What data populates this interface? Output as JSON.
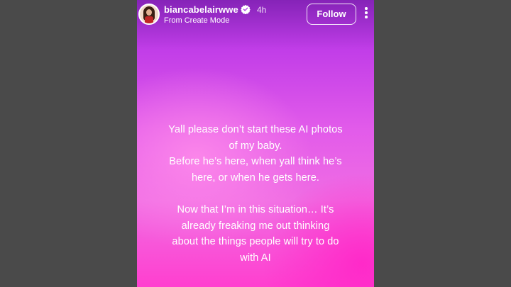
{
  "header": {
    "username": "biancabelairwwe",
    "time": "4h",
    "subtitle": "From Create Mode",
    "follow_label": "Follow",
    "verified_icon": "verified-badge-icon",
    "more_icon": "more-vertical-icon"
  },
  "story": {
    "paragraph_1": "Yall please don’t start these AI photos\nof my baby.\nBefore he’s here, when yall think he’s\nhere, or when he gets here.",
    "paragraph_2": "Now that I’m in this situation… It’s\nalready freaking me out thinking\nabout the things people will try to do\nwith AI"
  },
  "colors": {
    "gutter": "#4a4a4a",
    "gradient_top": "#a32be0",
    "gradient_mid": "#e25bea",
    "gradient_bottom": "#ff3fcf",
    "text": "#ffffff"
  }
}
